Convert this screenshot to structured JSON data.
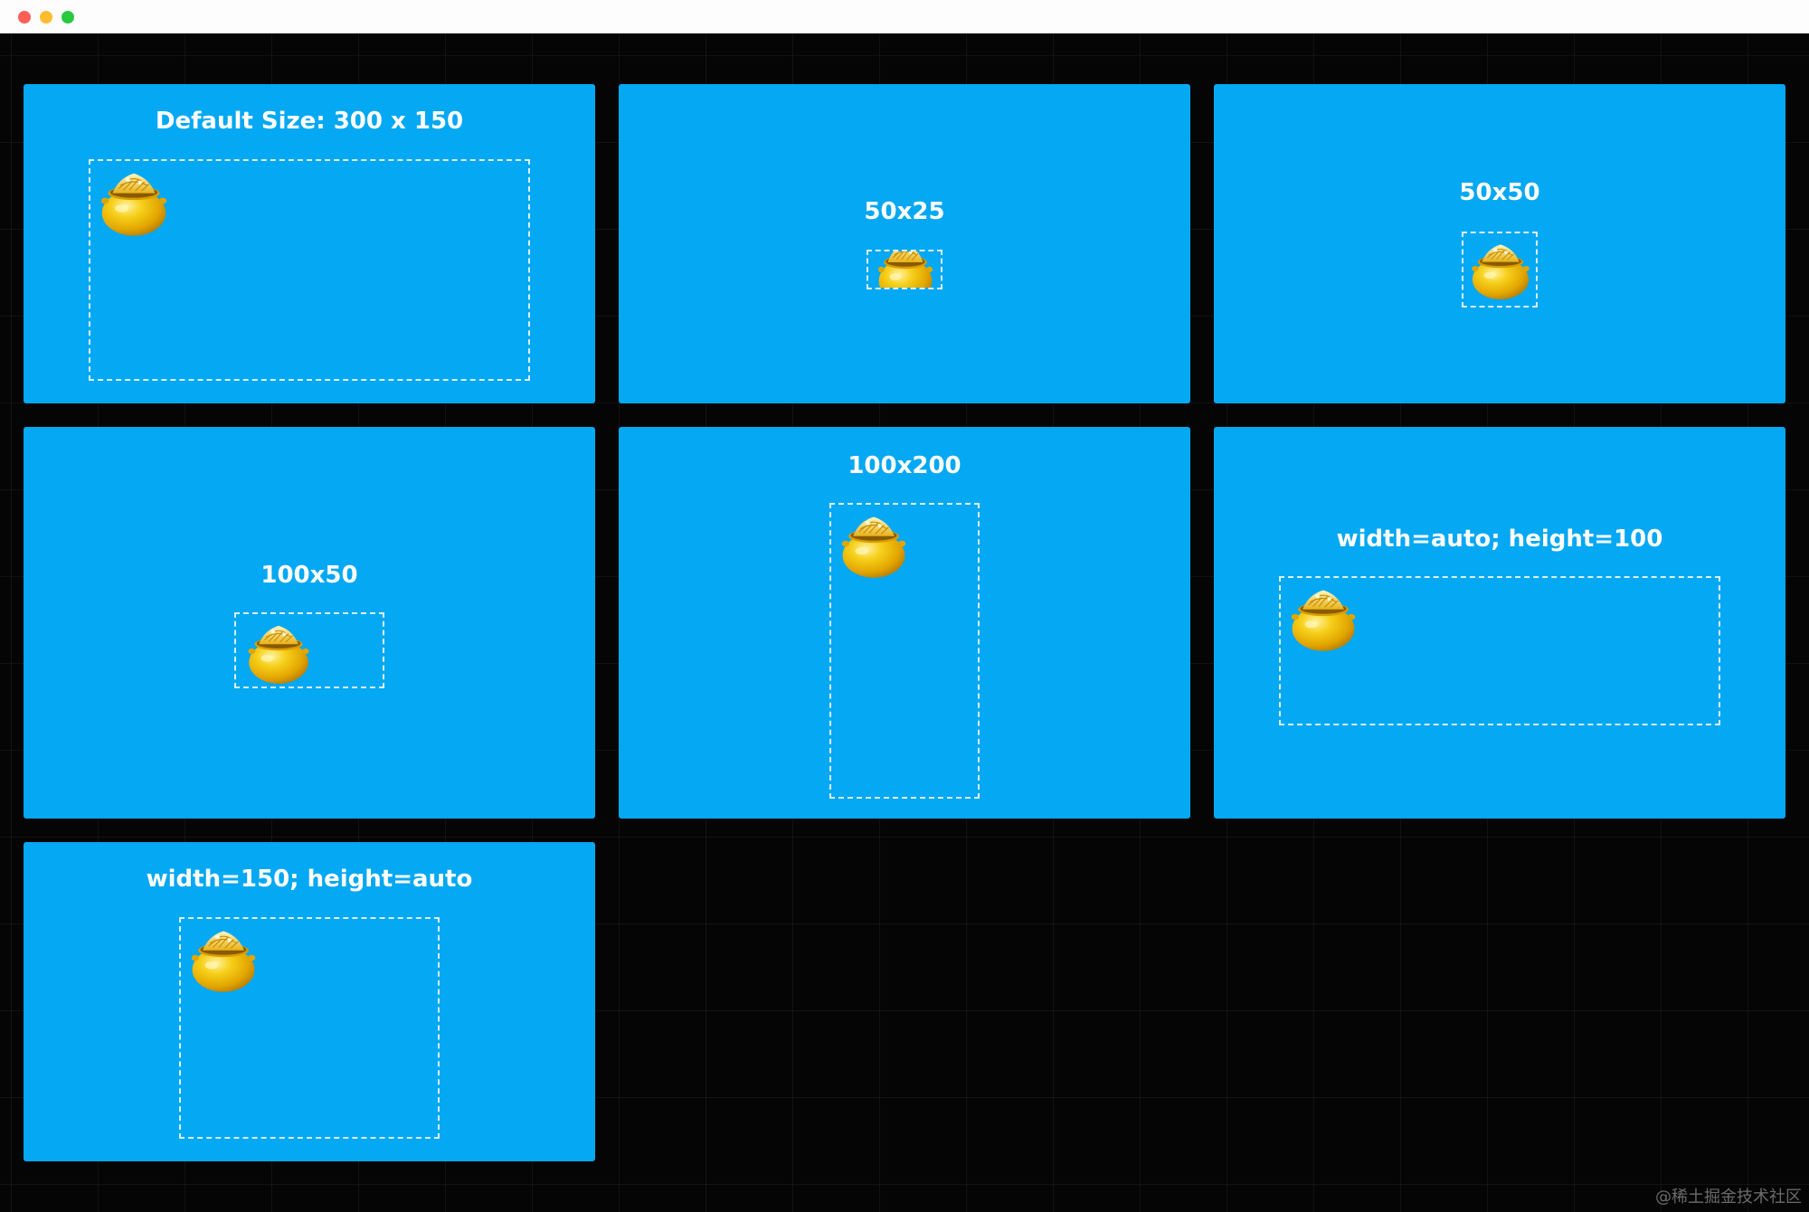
{
  "window": {
    "controls": [
      "close",
      "minimize",
      "maximize"
    ]
  },
  "colors": {
    "card_background": "#05a8f2",
    "canvas_background": "#050505",
    "frame_border": "#ffffff",
    "pot_gold": "#f2c200",
    "coin_gold": "#f7d84a"
  },
  "cards": [
    {
      "title": "Default Size: 300 x 150",
      "icon": "gold-pot-icon"
    },
    {
      "title": "50x25",
      "icon": "gold-pot-icon"
    },
    {
      "title": "50x50",
      "icon": "gold-pot-icon"
    },
    {
      "title": "100x50",
      "icon": "gold-pot-icon"
    },
    {
      "title": "100x200",
      "icon": "gold-pot-icon"
    },
    {
      "title": "width=auto; height=100",
      "icon": "gold-pot-icon"
    },
    {
      "title": "width=150; height=auto",
      "icon": "gold-pot-icon"
    }
  ],
  "watermark": "@稀土掘金技术社区"
}
